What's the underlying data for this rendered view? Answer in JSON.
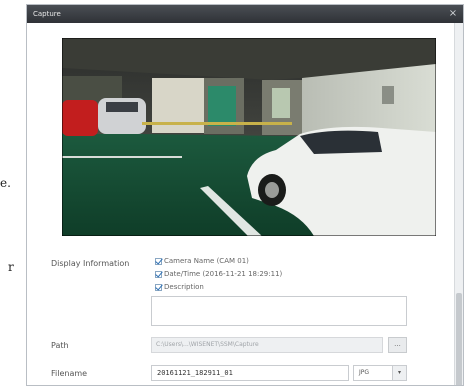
{
  "background_text": {
    "char1": "e.",
    "char2": "r"
  },
  "dialog": {
    "title": "Capture",
    "close_glyph": "×"
  },
  "display_information": {
    "label": "Display Information",
    "options": {
      "camera_name": "Camera Name (CAM 01)",
      "datetime": "Date/Time (2016-11-21 18:29:11)",
      "description": "Description"
    },
    "description_value": ""
  },
  "path": {
    "label": "Path",
    "value": "C:\\Users\\...\\WISENET\\SSM\\Capture",
    "browse_label": "..."
  },
  "filename": {
    "label": "Filename",
    "value": "20161121_182911_01",
    "extension": "JPG",
    "arrow": "▾"
  },
  "colors": {
    "titlebar": "#3b3e43",
    "accent": "#2d6fb3"
  }
}
